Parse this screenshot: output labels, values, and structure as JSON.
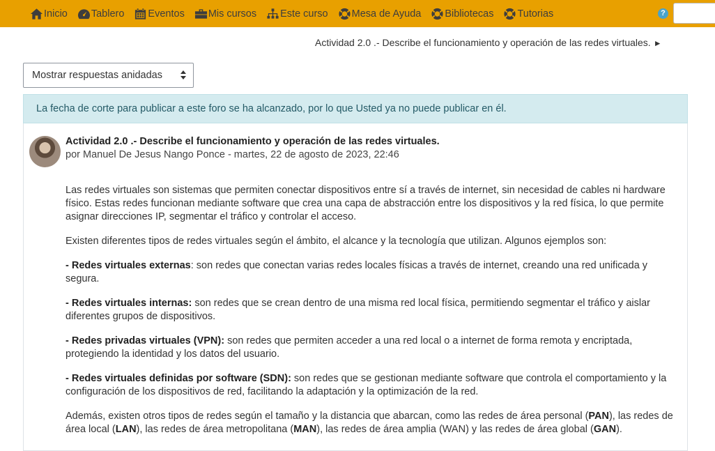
{
  "nav": {
    "items": [
      {
        "label": "Inicio",
        "icon": "home-icon"
      },
      {
        "label": "Tablero",
        "icon": "dashboard-icon"
      },
      {
        "label": "Eventos",
        "icon": "calendar-icon"
      },
      {
        "label": "Mis cursos",
        "icon": "briefcase-icon"
      },
      {
        "label": "Este curso",
        "icon": "sitemap-icon"
      },
      {
        "label": "Mesa de Ayuda",
        "icon": "lifebuoy-icon"
      },
      {
        "label": "Bibliotecas",
        "icon": "lifebuoy-icon"
      },
      {
        "label": "Tutorias",
        "icon": "lifebuoy-icon"
      }
    ],
    "help": "?",
    "bar_color": "#e8a000"
  },
  "next_activity": {
    "label": "Actividad 2.0 .- Describe el funcionamiento y operación de las redes virtuales.",
    "arrow": "►"
  },
  "display_mode": {
    "selected": "Mostrar respuestas anidadas"
  },
  "alert": {
    "text": "La fecha de corte para publicar a este foro se ha alcanzado, por lo que Usted ya no puede publicar en él."
  },
  "post": {
    "title": "Actividad 2.0 .- Describe el funcionamiento y operación de las redes virtuales.",
    "byline": "por Manuel De Jesus Nango Ponce - martes, 22 de agosto de 2023, 22:46",
    "intro": "Las redes virtuales son sistemas que permiten conectar dispositivos entre sí a través de internet, sin necesidad de cables ni hardware físico. Estas redes funcionan mediante software que crea una capa de abstracción entre los dispositivos y la red física, lo que permite asignar direcciones IP, segmentar el tráfico y controlar el acceso.",
    "types_intro": "Existen diferentes tipos de redes virtuales según el ámbito, el alcance y la tecnología que utilizan. Algunos ejemplos son:",
    "types": [
      {
        "term": "- Redes virtuales externas",
        "desc": ": son redes que conectan varias redes locales físicas a través de internet, creando una red unificada y segura."
      },
      {
        "term": "- Redes virtuales internas:",
        "desc": " son redes que se crean dentro de una misma red local física, permitiendo segmentar el tráfico y aislar diferentes grupos de dispositivos."
      },
      {
        "term": "- Redes privadas virtuales (VPN):",
        "desc": " son redes que permiten acceder a una red local o a internet de forma remota y encriptada, protegiendo la identidad y los datos del usuario."
      },
      {
        "term": "- Redes virtuales definidas por software (SDN):",
        "desc": " son redes que se gestionan mediante software que controla el comportamiento y la configuración de los dispositivos de red, facilitando la adaptación y la optimización de la red."
      }
    ],
    "closing": {
      "p1": "Además, existen otros tipos de redes según el tamaño y la distancia que abarcan, como las redes de área personal (",
      "pan": "PAN",
      "p2": "), las redes de área local (",
      "lan": "LAN",
      "p3": "), las redes de área metropolitana (",
      "man": "MAN",
      "p4": "), las redes de área amplia (WAN) y las redes de área global (",
      "gan": "GAN",
      "p5": ")."
    }
  }
}
